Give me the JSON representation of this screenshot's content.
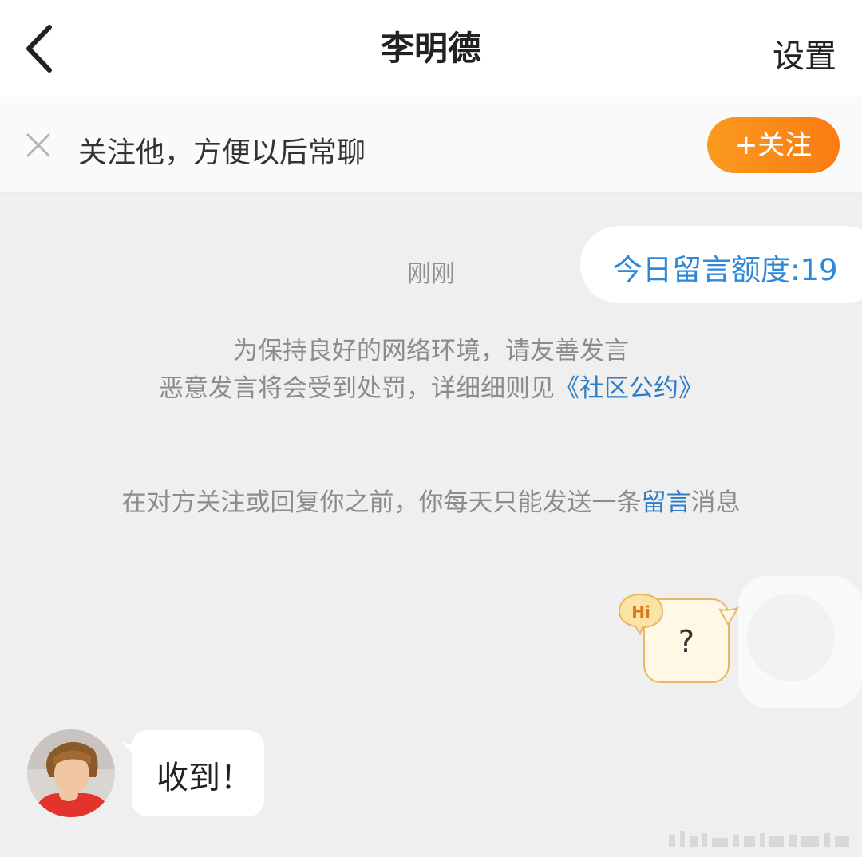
{
  "header": {
    "title": "李明德",
    "settings_label": "设置"
  },
  "follow_bar": {
    "text": "关注他，方便以后常聊",
    "button_label": "+关注",
    "accent": "#fa8a16"
  },
  "chat": {
    "quota_label": "今日留言额度:19",
    "timestamp": "刚刚",
    "notice_line1": "为保持良好的网络环境，请友善发言",
    "notice_line2_prefix": "恶意发言将会受到处罚，详细细则见",
    "notice_line2_link": "《社区公约》",
    "limit_prefix": "在对方关注或回复你之前，你每天只能发送一条",
    "limit_link": "留言",
    "limit_suffix": "消息",
    "sent_message": {
      "badge": "Hi",
      "text": "?"
    },
    "received_message": {
      "text": "收到！"
    }
  },
  "colors": {
    "link": "#2f7cc4",
    "quota": "#2e88d9",
    "background": "#efefef"
  }
}
